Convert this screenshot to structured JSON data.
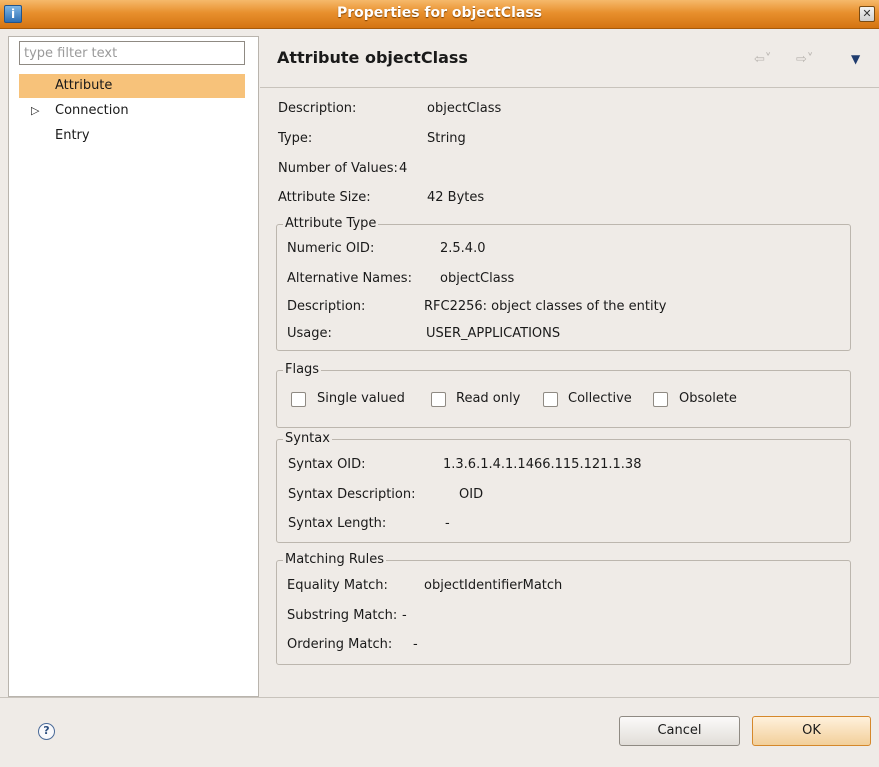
{
  "window": {
    "title": "Properties for objectClass",
    "close_glyph": "✕"
  },
  "left": {
    "filter_placeholder": "type filter text",
    "items": [
      {
        "label": "Attribute",
        "selected": true,
        "expandable": false
      },
      {
        "label": "Connection",
        "selected": false,
        "expandable": true
      },
      {
        "label": "Entry",
        "selected": false,
        "expandable": false
      }
    ]
  },
  "page": {
    "title": "Attribute objectClass",
    "icons": {
      "back": "back-arrow-icon",
      "forward": "forward-arrow-icon",
      "menu": "view-menu-icon"
    },
    "fields": {
      "description_label": "Description:",
      "description_value": "objectClass",
      "type_label": "Type:",
      "type_value": "String",
      "numvalues_label": "Number of Values:",
      "numvalues_value": "4",
      "size_label": "Attribute Size:",
      "size_value": "42 Bytes"
    },
    "attribute_type": {
      "title": "Attribute Type",
      "oid_label": "Numeric OID:",
      "oid_value": "2.5.4.0",
      "alt_label": "Alternative Names:",
      "alt_value": "objectClass",
      "desc_label": "Description:",
      "desc_value": "RFC2256: object classes of the entity",
      "usage_label": "Usage:",
      "usage_value": "USER_APPLICATIONS"
    },
    "flags": {
      "title": "Flags",
      "single": "Single valued",
      "readonly": "Read only",
      "collective": "Collective",
      "obsolete": "Obsolete"
    },
    "syntax": {
      "title": "Syntax",
      "oid_label": "Syntax OID:",
      "oid_value": "1.3.6.1.4.1.1466.115.121.1.38",
      "desc_label": "Syntax Description:",
      "desc_value": "OID",
      "len_label": "Syntax Length:",
      "len_value": "-"
    },
    "matching": {
      "title": "Matching Rules",
      "eq_label": "Equality Match:",
      "eq_value": "objectIdentifierMatch",
      "sub_label": "Substring Match:",
      "sub_value": "-",
      "ord_label": "Ordering Match:",
      "ord_value": "-"
    }
  },
  "footer": {
    "help_glyph": "?",
    "cancel": "Cancel",
    "ok": "OK"
  }
}
